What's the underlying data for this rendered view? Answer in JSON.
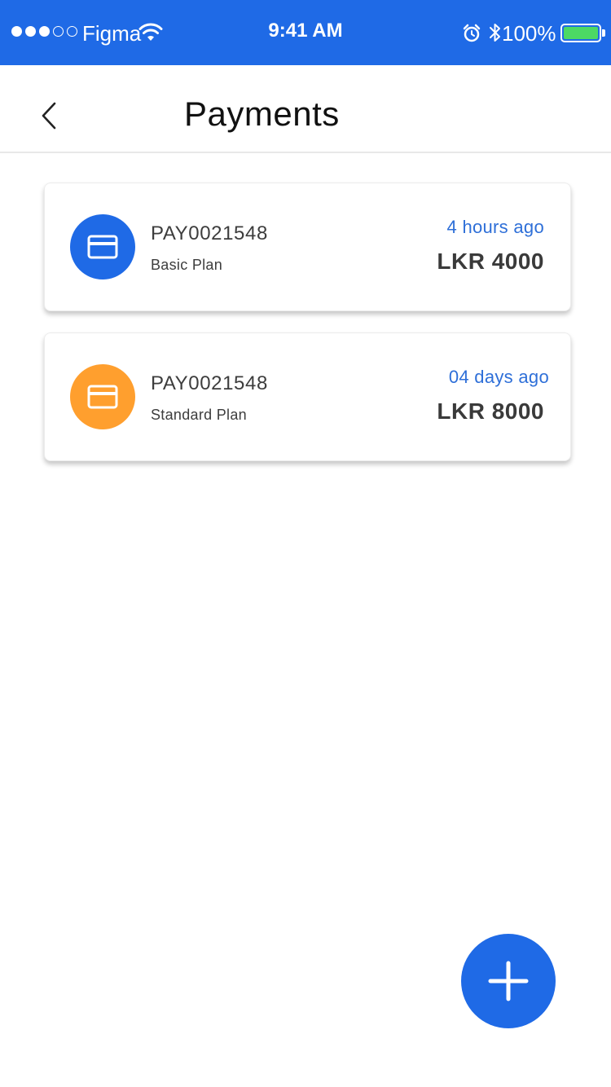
{
  "status_bar": {
    "carrier": "Figma",
    "time": "9:41 AM",
    "battery_percent": "100%",
    "battery_level": 1.0,
    "icons": [
      "signal-dots-icon",
      "wifi-icon",
      "alarm-icon",
      "bluetooth-icon",
      "battery-icon"
    ]
  },
  "header": {
    "title": "Payments",
    "back_icon": "chevron-left-icon"
  },
  "payments": [
    {
      "id": "PAY0021548",
      "plan": "Basic Plan",
      "time_ago": "4 hours ago",
      "amount": "LKR 4000",
      "icon": "credit-card-icon",
      "color": "#1f6ae6"
    },
    {
      "id": "PAY0021548",
      "plan": "Standard Plan",
      "time_ago": "04 days ago",
      "amount": "LKR 8000",
      "icon": "credit-card-icon",
      "color": "#ff9f2e"
    }
  ],
  "fab": {
    "icon": "plus-icon",
    "color": "#1f6ae6"
  },
  "colors": {
    "primary": "#1f6ae6",
    "accent_orange": "#ff9f2e",
    "link_blue": "#2e6fd8"
  }
}
